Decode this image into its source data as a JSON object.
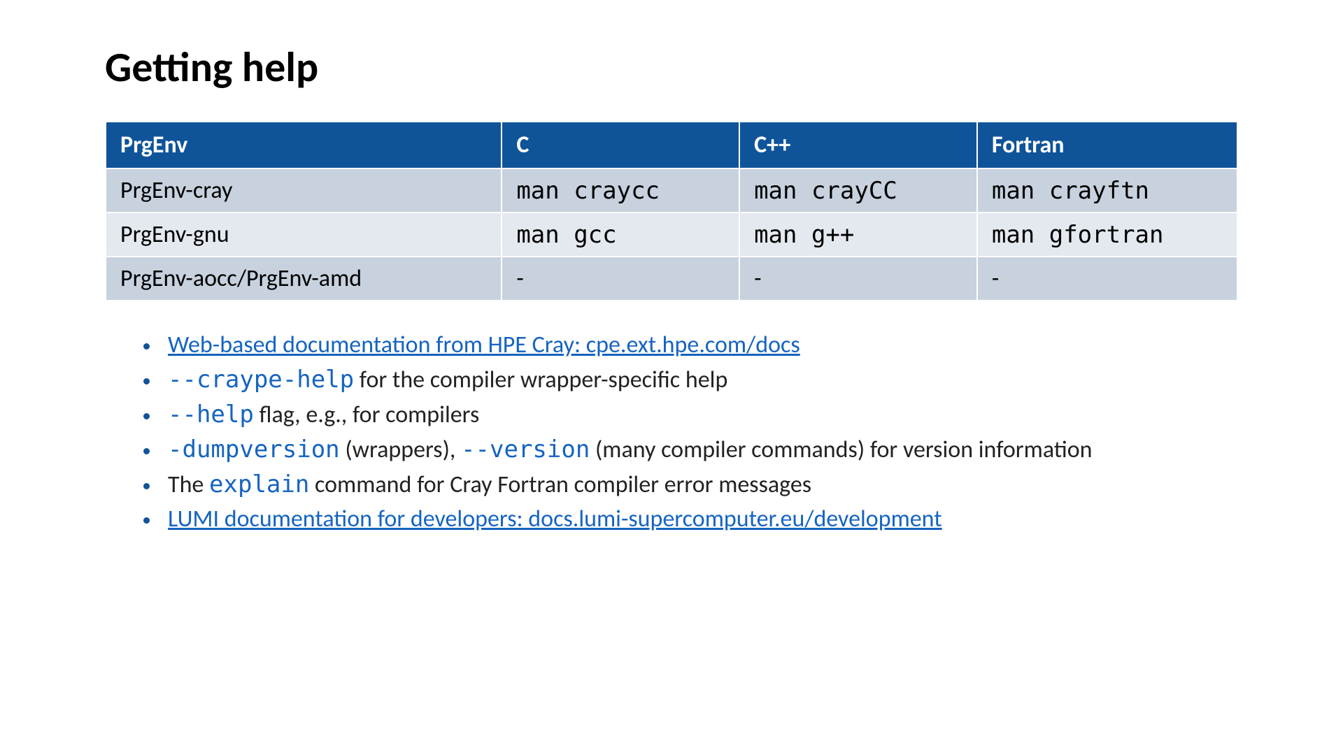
{
  "title": "Getting help",
  "table": {
    "headers": [
      "PrgEnv",
      "C",
      "C++",
      "Fortran"
    ],
    "rows": [
      {
        "env": "PrgEnv-cray",
        "c": "man craycc",
        "cpp": "man crayCC",
        "fortran": "man crayftn"
      },
      {
        "env": "PrgEnv-gnu",
        "c": "man gcc",
        "cpp": "man g++",
        "fortran": "man gfortran"
      },
      {
        "env": "PrgEnv-aocc/PrgEnv-amd",
        "c": "-",
        "cpp": "-",
        "fortran": "-"
      }
    ]
  },
  "bullets": {
    "b1_link": "Web-based documentation from HPE Cray: cpe.ext.hpe.com/docs",
    "b2_code": "--craype-help",
    "b2_text": " for the compiler wrapper-specific help",
    "b3_code": "--help",
    "b3_text": " flag, e.g., for compilers",
    "b4_code1": "-dumpversion",
    "b4_text1": " (wrappers), ",
    "b4_code2": "--version",
    "b4_text2": " (many compiler commands) for version information",
    "b5_text1": "The ",
    "b5_code": "explain",
    "b5_text2": " command for Cray Fortran compiler error messages",
    "b6_link": "LUMI documentation for developers: docs.lumi-supercomputer.eu/development"
  }
}
